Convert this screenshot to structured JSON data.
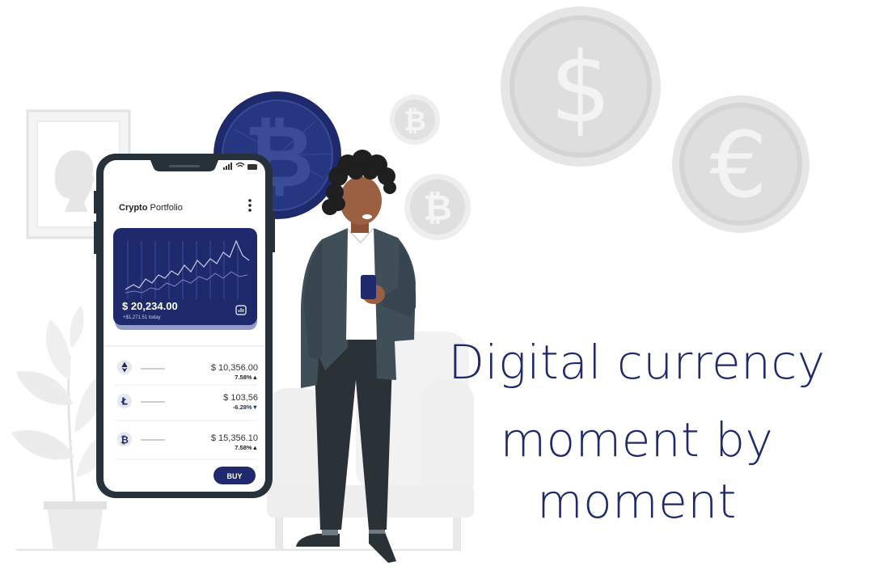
{
  "phone": {
    "title_bold": "Crypto",
    "title_rest": " Portfolio",
    "balance": "$ 20,234.00",
    "balance_change": "+$1,271.51 today",
    "buy_label": "BUY",
    "assets": [
      {
        "icon": "ethereum-icon",
        "price": "$ 10,356.00",
        "change": "7.58%▲"
      },
      {
        "icon": "litecoin-icon",
        "price": "$ 103,56",
        "change": "-6.28%▼"
      },
      {
        "icon": "bitcoin-icon",
        "price": "$ 15,356.10",
        "change": "7.58%▲"
      }
    ]
  },
  "headline": {
    "line1": "Digital currency",
    "line2": "moment by moment"
  },
  "colors": {
    "navy": "#1e2a6b",
    "coin_grey": "#dcdcdc",
    "suit": "#3f4e57",
    "phone_frame": "#26313a"
  }
}
